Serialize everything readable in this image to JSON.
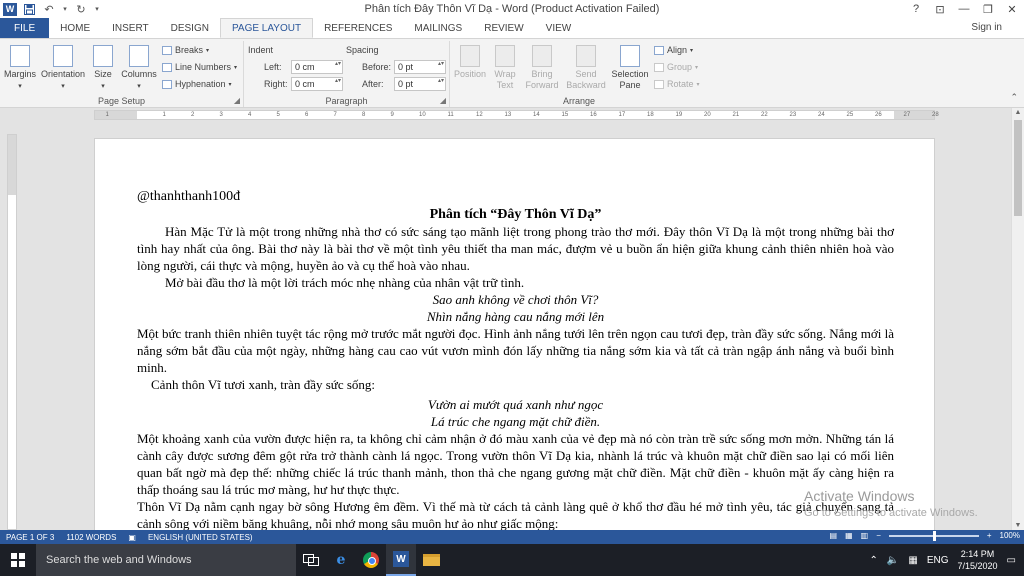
{
  "window": {
    "title": "Phân tích Đây Thôn Vĩ Dạ - Word (Product Activation Failed)",
    "controls": [
      "?",
      "⊡",
      "—",
      "❐",
      "✕"
    ]
  },
  "quick_access": {
    "logo": "W",
    "save_icon": "save-icon",
    "undo_icon": "undo-icon",
    "redo_icon": "redo-icon"
  },
  "tabs": [
    {
      "label": "FILE"
    },
    {
      "label": "HOME"
    },
    {
      "label": "INSERT"
    },
    {
      "label": "DESIGN"
    },
    {
      "label": "PAGE LAYOUT"
    },
    {
      "label": "REFERENCES"
    },
    {
      "label": "MAILINGS"
    },
    {
      "label": "REVIEW"
    },
    {
      "label": "VIEW"
    }
  ],
  "signin": "Sign in",
  "ribbon": {
    "page_setup": {
      "label": "Page Setup",
      "margins": "Margins",
      "orientation": "Orientation",
      "size": "Size",
      "columns": "Columns",
      "breaks": "Breaks",
      "line_numbers": "Line Numbers",
      "hyphenation": "Hyphenation"
    },
    "paragraph": {
      "label": "Paragraph",
      "indent": "Indent",
      "spacing": "Spacing",
      "left_label": "Left:",
      "right_label": "Right:",
      "before_label": "Before:",
      "after_label": "After:",
      "left_value": "0 cm",
      "right_value": "0 cm",
      "before_value": "0 pt",
      "after_value": "0 pt"
    },
    "arrange": {
      "label": "Arrange",
      "position": "Position",
      "wrap_text": "Wrap Text",
      "bring_forward": "Bring Forward",
      "send_backward": "Send Backward",
      "selection_pane": "Selection Pane",
      "align": "Align",
      "group": "Group",
      "rotate": "Rotate"
    }
  },
  "ruler_ticks": [
    "1",
    "1",
    "2",
    "3",
    "4",
    "5",
    "6",
    "7",
    "8",
    "9",
    "10",
    "11",
    "12",
    "13",
    "14",
    "15",
    "16",
    "17",
    "18",
    "19",
    "20",
    "21",
    "22",
    "23",
    "24",
    "25",
    "26",
    "27",
    "28"
  ],
  "document": {
    "author": "@thanhthanh100đ",
    "title": "Phân tích “Đây Thôn Vĩ Dạ”",
    "p1": "Hàn Mặc Tử là một trong những nhà thơ có sức sáng tạo mãnh liệt trong phong trào thơ mới. Đây thôn Vĩ Dạ là một trong những bài thơ tình hay nhất của ông. Bài thơ này là bài thơ về một tình yêu thiết tha man mác, đượm vẻ u buồn ẩn hiện giữa khung cảnh thiên nhiên hoà vào lòng người, cái thực và mộng, huyền ảo và cụ thể hoà vào nhau.",
    "p2": "Mở bài đầu thơ là một lời trách móc nhẹ nhàng của nhân vật trữ tình.",
    "v1": "Sao anh không về chơi thôn Vĩ?",
    "v2": "Nhìn nắng hàng cau nắng mới lên",
    "p3": "Một bức tranh thiên nhiên tuyệt tác rộng mở trước mắt người đọc. Hình ảnh nắng tưới lên trên ngọn cau tươi đẹp, tràn đầy sức sống. Nắng mới là nắng sớm bắt đầu của một ngày, những hàng cau cao vút vươn mình đón lấy những tia nắng sớm kia và tất cả tràn ngập ánh nắng và buổi bình minh.",
    "p4": "Cảnh thôn Vĩ tươi xanh, tràn đầy sức sống:",
    "v3": "Vườn ai mướt quá xanh như ngọc",
    "v4": "Lá trúc che ngang mặt chữ điền.",
    "p5": "Một khoảng xanh của vườn được hiện ra, ta không chỉ cảm nhận ở đó màu xanh của vẻ đẹp mà nó còn tràn trề sức sống mơn mởn. Những tán lá cành cây được sương đêm gột rửa trở thành cành lá ngọc. Trong vườn thôn Vĩ Dạ kia, nhành lá trúc và khuôn mặt chữ điền sao lại có mối liên quan bất ngờ mà đẹp thế: những chiếc lá trúc thanh mảnh, thon thả che ngang gương mặt chữ điền. Mặt chữ điền - khuôn mặt ấy càng hiện ra thấp thoáng sau lá trúc mơ màng, hư hư thực thực.",
    "p6": "Thôn Vĩ Dạ nằm cạnh ngay bờ sông Hương êm đềm. Vì thế mà từ cách tả cảnh làng quê ở khổ thơ đầu hé mở tình yêu, tác giả chuyển sang tả cảnh sông với niềm băng khuâng, nỗi nhớ mong sâu muôn hư ảo như giấc mộng:"
  },
  "watermark": {
    "line1": "Activate Windows",
    "line2": "Go to Settings to activate Windows."
  },
  "status": {
    "page": "PAGE 1 OF 3",
    "words": "1102 WORDS",
    "language": "ENGLISH (UNITED STATES)",
    "zoom": "100%"
  },
  "taskbar": {
    "search_placeholder": "Search the web and Windows",
    "language": "ENG",
    "time": "2:14 PM",
    "date": "7/15/2020"
  },
  "colors": {
    "accent": "#2b579a",
    "taskbar": "#1c1f26"
  }
}
